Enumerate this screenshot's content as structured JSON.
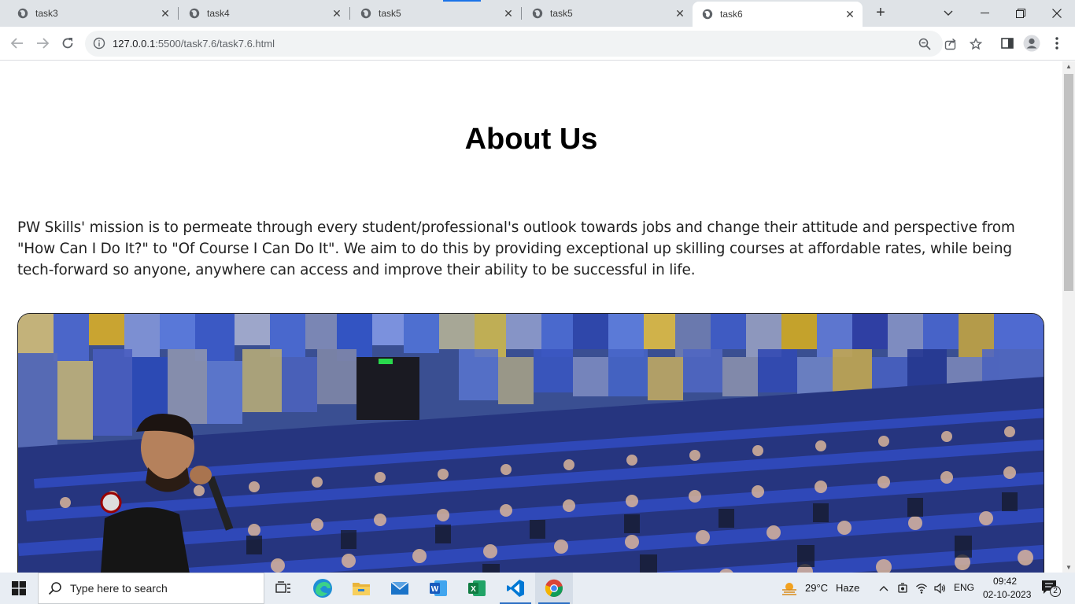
{
  "browser": {
    "tabs": [
      {
        "title": "task3",
        "active": false
      },
      {
        "title": "task4",
        "active": false
      },
      {
        "title": "task5",
        "active": false
      },
      {
        "title": "task5",
        "active": false
      },
      {
        "title": "task6",
        "active": true
      }
    ],
    "url_host": "127.0.0.1",
    "url_path": ":5500/task7.6/task7.6.html"
  },
  "page": {
    "title": "About Us",
    "mission": "PW Skills' mission is to permeate through every student/professional's outlook towards jobs and change their attitude and perspective from \"How Can I Do It?\" to \"Of Course I Can Do It\". We aim to do this by providing exceptional up skilling courses at affordable rates, while being tech-forward so anyone, anywhere can access and improve their ability to be successful in life."
  },
  "taskbar": {
    "search_placeholder": "Type here to search",
    "weather_temp": "29°C",
    "weather_desc": "Haze",
    "language": "ENG",
    "time": "09:42",
    "date": "02-10-2023",
    "notification_count": "2"
  },
  "colors": {
    "accent": "#1a73e8",
    "tabstrip": "#dfe3e7",
    "taskbar": "#e8edf3"
  }
}
